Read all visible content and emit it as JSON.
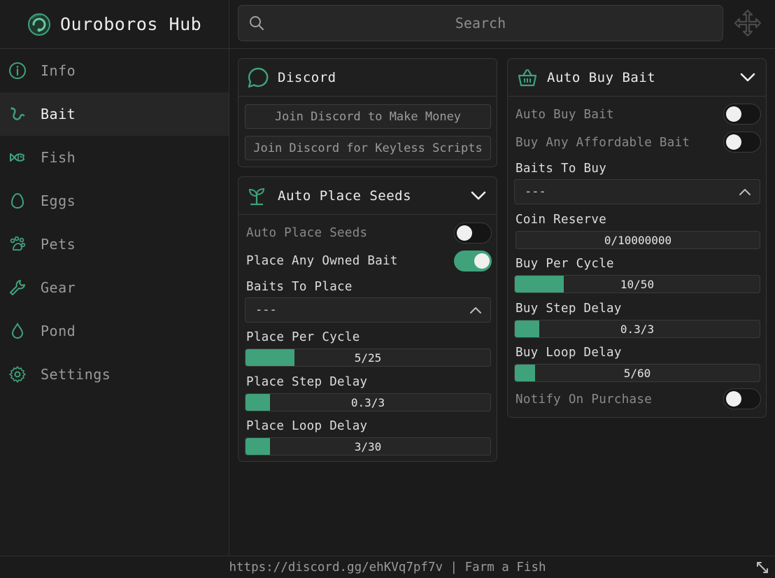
{
  "app": {
    "title": "Ouroboros Hub"
  },
  "colors": {
    "accent": "#3fa27a",
    "background": "#1b1b1b",
    "panel": "#1f1f1f"
  },
  "sidebar": {
    "items": [
      {
        "label": "Info",
        "icon": "info-icon",
        "active": false
      },
      {
        "label": "Bait",
        "icon": "worm-icon",
        "active": true
      },
      {
        "label": "Fish",
        "icon": "fish-icon",
        "active": false
      },
      {
        "label": "Eggs",
        "icon": "egg-icon",
        "active": false
      },
      {
        "label": "Pets",
        "icon": "paw-icon",
        "active": false
      },
      {
        "label": "Gear",
        "icon": "wrench-icon",
        "active": false
      },
      {
        "label": "Pond",
        "icon": "droplet-icon",
        "active": false
      },
      {
        "label": "Settings",
        "icon": "gear-icon",
        "active": false
      }
    ]
  },
  "search": {
    "placeholder": "Search"
  },
  "discord": {
    "title": "Discord",
    "buttons": [
      "Join Discord to Make Money",
      "Join Discord for Keyless Scripts"
    ]
  },
  "auto_place_seeds": {
    "title": "Auto Place Seeds",
    "toggle_auto_place": {
      "label": "Auto Place Seeds",
      "on": false
    },
    "toggle_any_owned": {
      "label": "Place Any Owned Bait",
      "on": true
    },
    "baits_to_place": {
      "label": "Baits To Place",
      "value": "---"
    },
    "place_per_cycle": {
      "label": "Place Per Cycle",
      "value": "5/25",
      "fraction": 0.2
    },
    "place_step_delay": {
      "label": "Place Step Delay",
      "value": "0.3/3",
      "fraction": 0.1
    },
    "place_loop_delay": {
      "label": "Place Loop Delay",
      "value": "3/30",
      "fraction": 0.1
    }
  },
  "auto_buy_bait": {
    "title": "Auto Buy Bait",
    "toggle_auto_buy": {
      "label": "Auto Buy Bait",
      "on": false
    },
    "toggle_any_affordable": {
      "label": "Buy Any Affordable Bait",
      "on": false
    },
    "baits_to_buy": {
      "label": "Baits To Buy",
      "value": "---"
    },
    "coin_reserve": {
      "label": "Coin Reserve",
      "value": "0/10000000"
    },
    "buy_per_cycle": {
      "label": "Buy Per Cycle",
      "value": "10/50",
      "fraction": 0.2
    },
    "buy_step_delay": {
      "label": "Buy Step Delay",
      "value": "0.3/3",
      "fraction": 0.1
    },
    "buy_loop_delay": {
      "label": "Buy Loop Delay",
      "value": "5/60",
      "fraction": 0.083
    },
    "toggle_notify": {
      "label": "Notify On Purchase",
      "on": false
    }
  },
  "footer": {
    "text": "https://discord.gg/ehKVq7pf7v | Farm a Fish"
  }
}
